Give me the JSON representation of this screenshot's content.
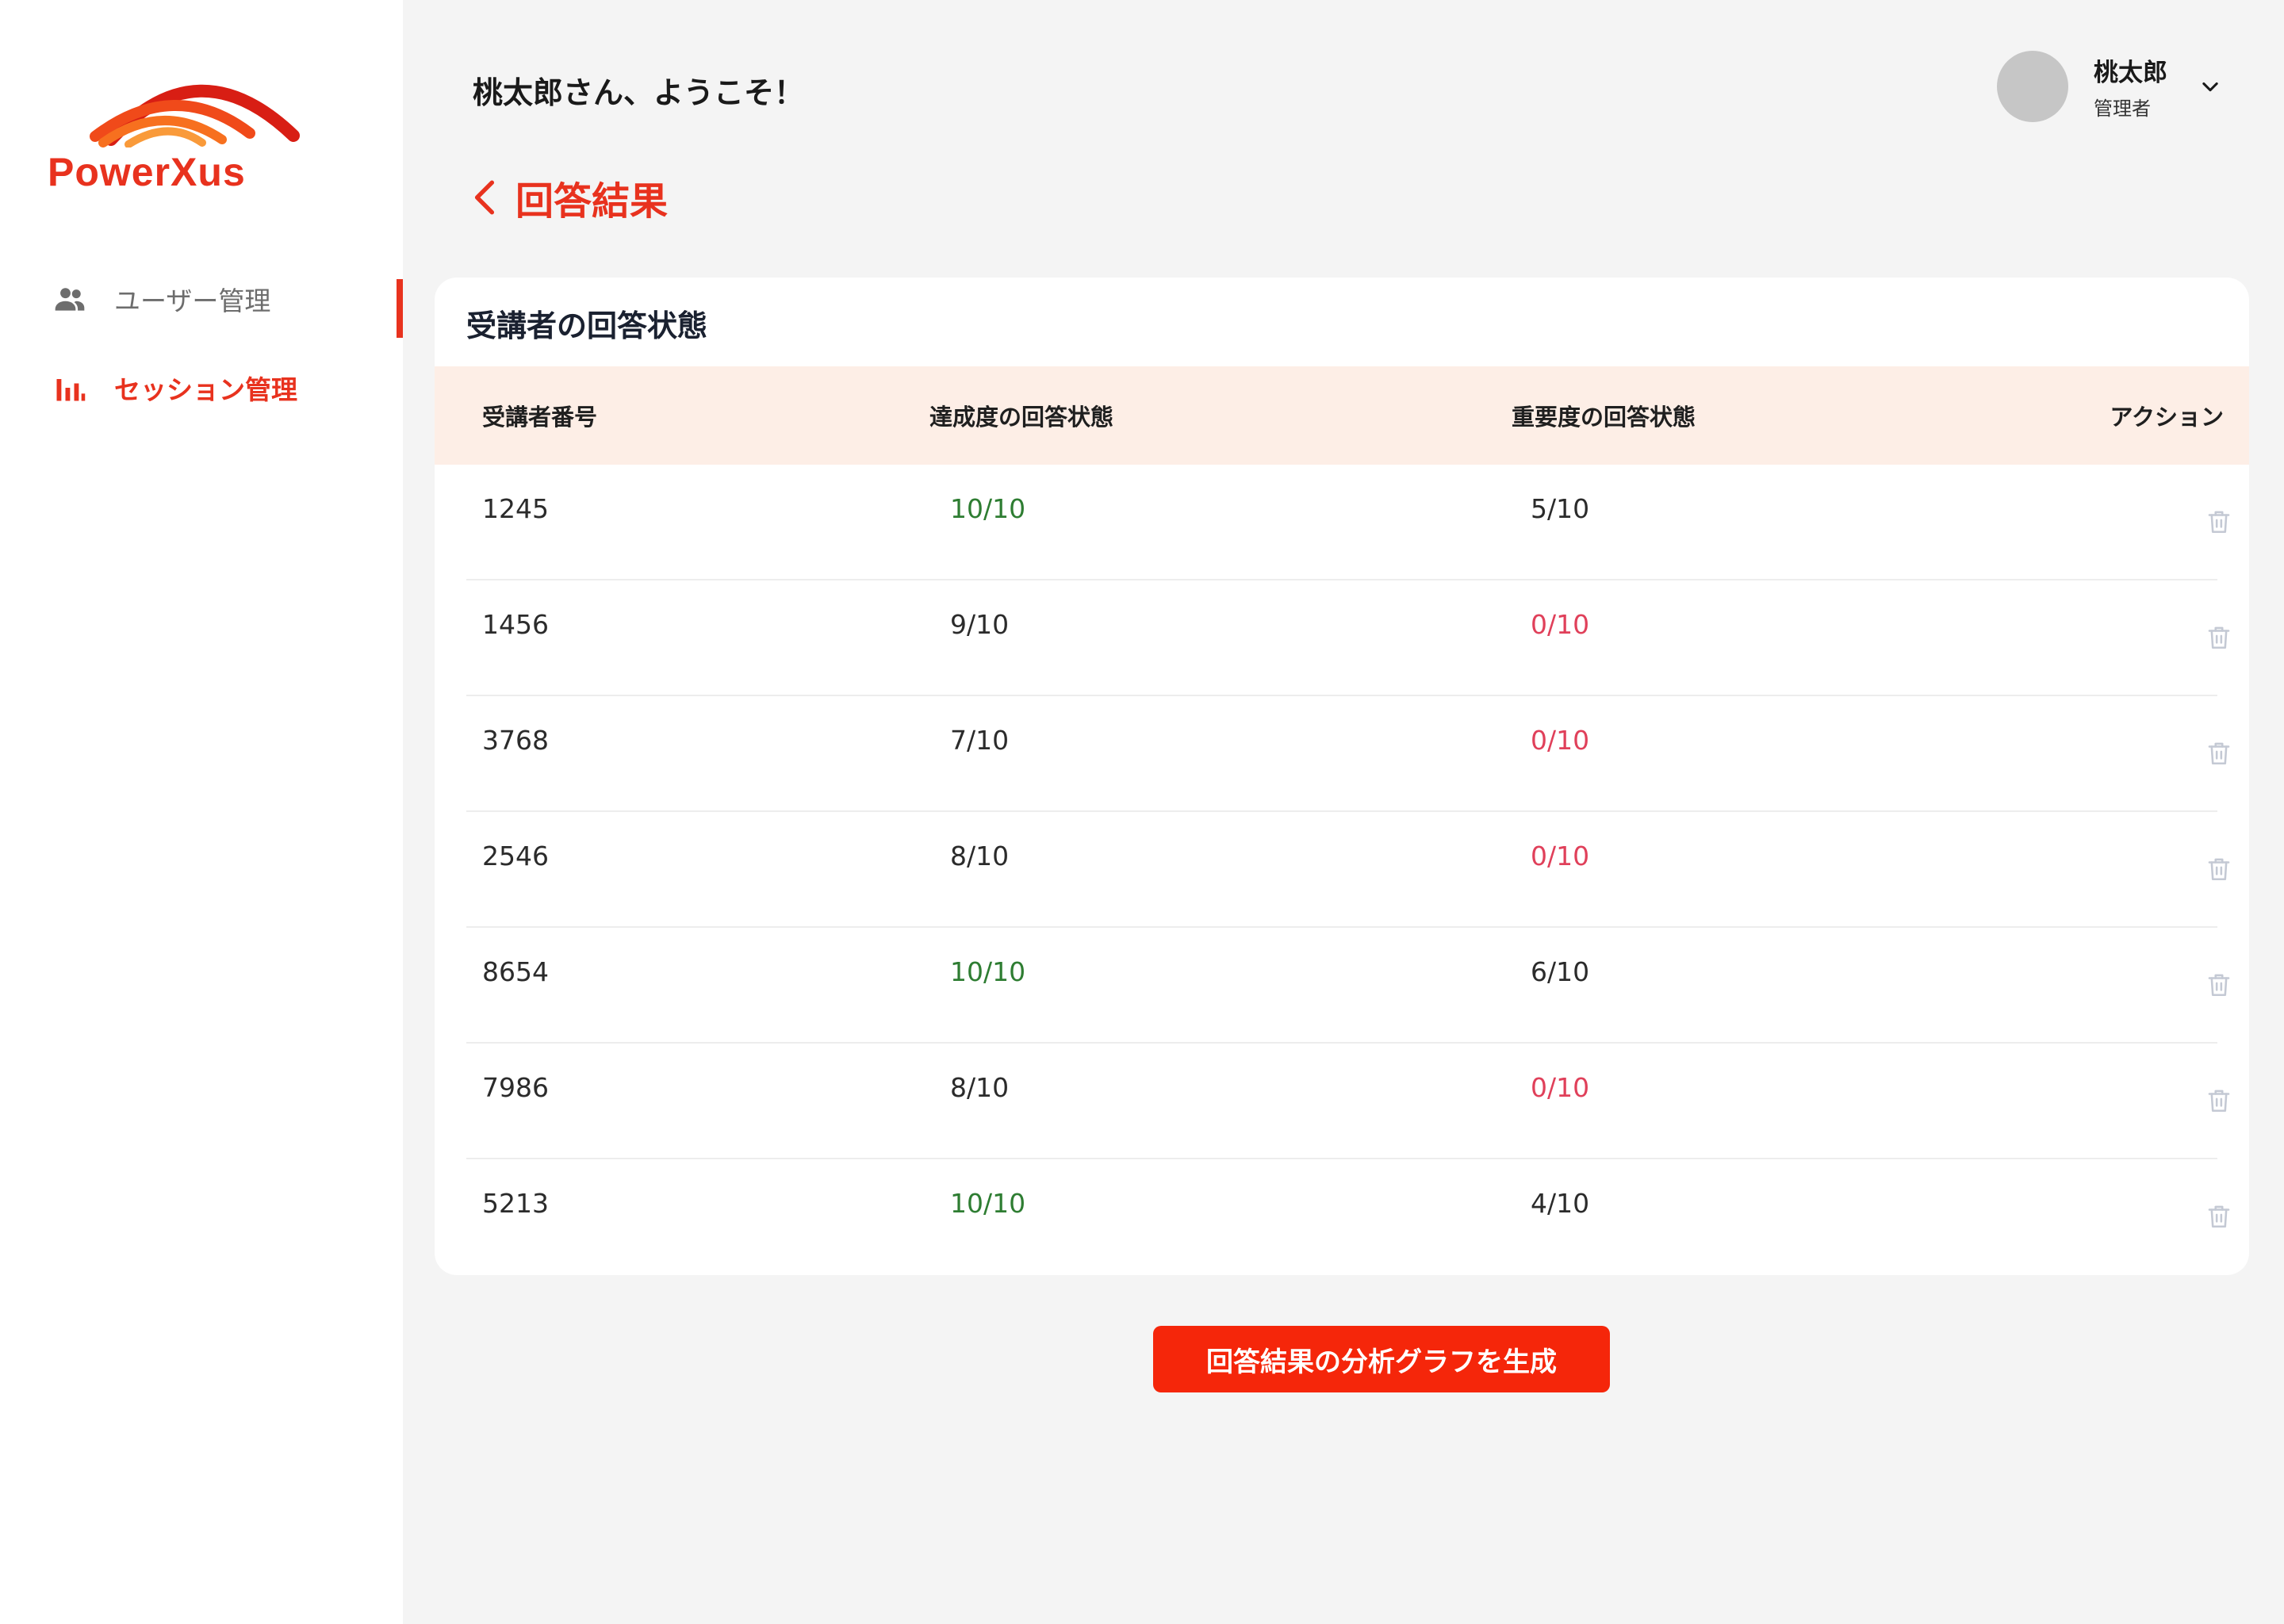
{
  "brand": {
    "name": "PowerXus",
    "accent_color": "#e8321e"
  },
  "sidebar": {
    "items": [
      {
        "label": "ユーザー管理",
        "icon": "users-icon",
        "active": false
      },
      {
        "label": "セッション管理",
        "icon": "bar-chart-icon",
        "active": true
      }
    ]
  },
  "header": {
    "welcome": "桃太郎さん、ようこそ！",
    "user": {
      "name": "桃太郎",
      "role": "管理者",
      "menu_icon": "chevron-down-icon"
    }
  },
  "page": {
    "title": "回答結果",
    "back_icon": "chevron-left-icon"
  },
  "card": {
    "title": "受講者の回答状態",
    "columns": [
      "受講者番号",
      "達成度の回答状態",
      "重要度の回答状態",
      "アクション"
    ],
    "rows": [
      {
        "id": "1245",
        "achievement": "10/10",
        "importance": "5/10"
      },
      {
        "id": "1456",
        "achievement": "9/10",
        "importance": "0/10"
      },
      {
        "id": "3768",
        "achievement": "7/10",
        "importance": "0/10"
      },
      {
        "id": "2546",
        "achievement": "8/10",
        "importance": "0/10"
      },
      {
        "id": "8654",
        "achievement": "10/10",
        "importance": "6/10"
      },
      {
        "id": "7986",
        "achievement": "8/10",
        "importance": "0/10"
      },
      {
        "id": "5213",
        "achievement": "10/10",
        "importance": "4/10"
      }
    ],
    "row_action_icon": "trash-icon"
  },
  "actions": {
    "generate_label": "回答結果の分析グラフを生成"
  },
  "colors": {
    "complete": "#2e7d32",
    "empty": "#e0405a",
    "header_bg": "#fdeee6"
  }
}
